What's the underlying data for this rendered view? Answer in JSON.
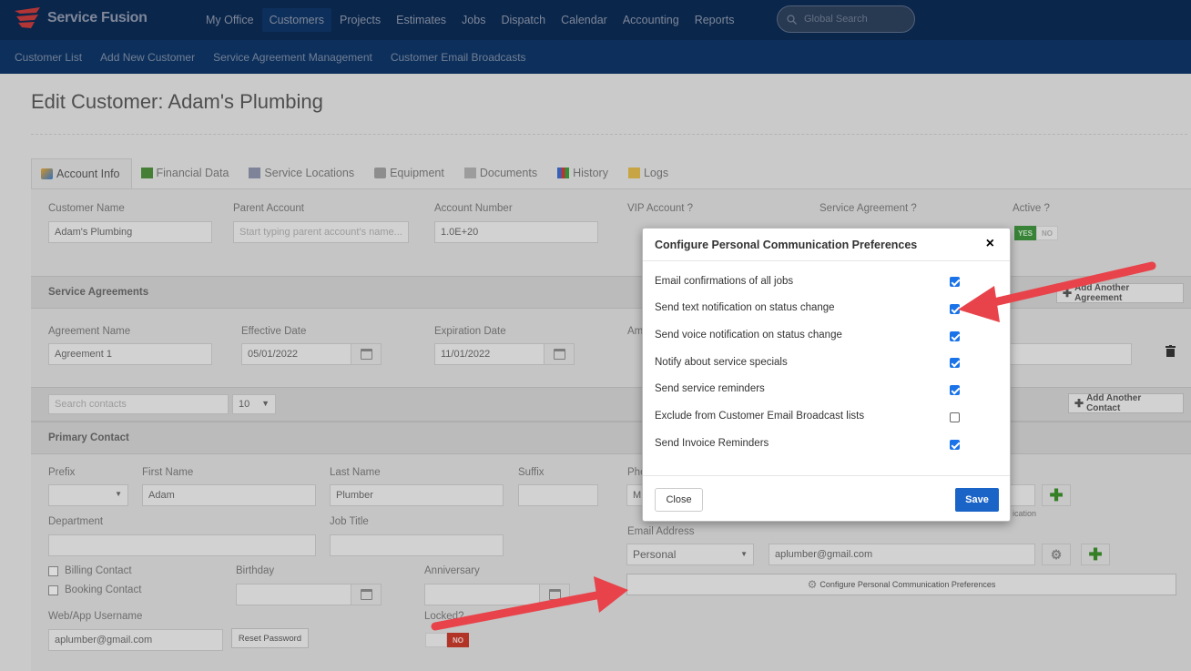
{
  "brand": {
    "name": "Service Fusion"
  },
  "mainnav": [
    "My Office",
    "Customers",
    "Projects",
    "Estimates",
    "Jobs",
    "Dispatch",
    "Calendar",
    "Accounting",
    "Reports"
  ],
  "search": {
    "placeholder": "Global Search"
  },
  "subnav": [
    "Customer List",
    "Add New Customer",
    "Service Agreement Management",
    "Customer Email Broadcasts"
  ],
  "page": {
    "title": "Edit Customer: Adam's Plumbing"
  },
  "tabs": [
    "Account Info",
    "Financial Data",
    "Service Locations",
    "Equipment",
    "Documents",
    "History",
    "Logs"
  ],
  "account": {
    "customer_name_label": "Customer Name",
    "customer_name": "Adam's Plumbing",
    "parent_label": "Parent Account",
    "parent_placeholder": "Start typing parent account's name...",
    "account_number_label": "Account Number",
    "account_number": "1.0E+20",
    "vip_label": "VIP Account ?",
    "sa_label": "Service Agreement ?",
    "active_label": "Active ?",
    "active_yes": "YES",
    "active_no": "NO"
  },
  "agreements": {
    "section_title": "Service Agreements",
    "add_label": "Add Another Agreement",
    "name_label": "Agreement Name",
    "name": "Agreement 1",
    "eff_label": "Effective Date",
    "eff": "05/01/2022",
    "exp_label": "Expiration Date",
    "exp": "11/01/2022",
    "amount_label_partial": "Am"
  },
  "contacts": {
    "search_placeholder": "Search contacts",
    "page_size": "10",
    "add_label": "Add Another Contact",
    "section_title": "Primary Contact",
    "prefix_label": "Prefix",
    "first_label": "First Name",
    "first": "Adam",
    "last_label": "Last Name",
    "last": "Plumber",
    "suffix_label": "Suffix",
    "phone_label_partial": "Pho",
    "phone_type_partial": "M",
    "dept_label": "Department",
    "job_label": "Job Title",
    "billing_label": "Billing Contact",
    "booking_label": "Booking Contact",
    "birthday_label": "Birthday",
    "anniversary_label": "Anniversary",
    "web_label": "Web/App Username",
    "web": "aplumber@gmail.com",
    "reset_label": "Reset Password",
    "locked_label": "Locked?",
    "locked_off": "NO",
    "email_label": "Email Address",
    "email_type": "Personal",
    "email": "aplumber@gmail.com",
    "notification_partial": "ication",
    "configure_label": "Configure Personal Communication Preferences"
  },
  "modal": {
    "title": "Configure Personal Communication Preferences",
    "close_glyph": "×",
    "prefs": [
      {
        "label": "Email confirmations of all jobs",
        "checked": true
      },
      {
        "label": "Send text notification on status change",
        "checked": true
      },
      {
        "label": "Send voice notification on status change",
        "checked": true
      },
      {
        "label": "Notify about service specials",
        "checked": true
      },
      {
        "label": "Send service reminders",
        "checked": true
      },
      {
        "label": "Exclude from Customer Email Broadcast lists",
        "checked": false
      },
      {
        "label": "Send Invoice Reminders",
        "checked": true
      }
    ],
    "close_label": "Close",
    "save_label": "Save"
  },
  "colors": {
    "topbar": "#0b2a52",
    "subbar": "#0f3463",
    "save": "#1a64c8",
    "checkbox": "#1a73e8",
    "annotation": "#e8434a",
    "toggle_yes": "#3d8f3d",
    "toggle_no": "#c0392b"
  }
}
